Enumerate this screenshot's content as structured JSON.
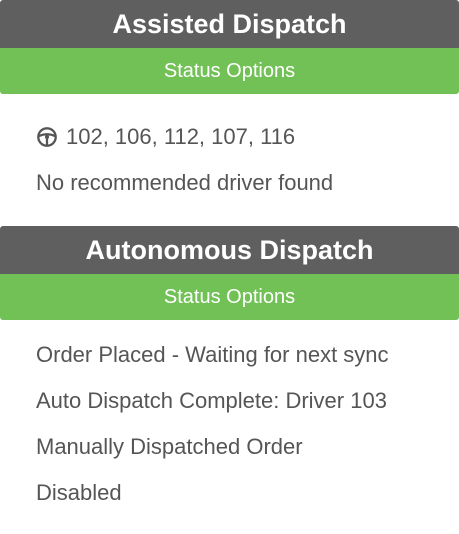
{
  "assisted": {
    "title": "Assisted Dispatch",
    "status_label": "Status Options",
    "drivers_icon": "steering-wheel-icon",
    "drivers": "102, 106, 112, 107, 116",
    "note": "No recommended driver found"
  },
  "autonomous": {
    "title": "Autonomous Dispatch",
    "status_label": "Status Options",
    "statuses": [
      "Order Placed - Waiting for next sync",
      "Auto Dispatch Complete: Driver 103",
      "Manually Dispatched Order",
      "Disabled"
    ]
  },
  "colors": {
    "header_bg": "#5f5f5f",
    "status_bg": "#72c157",
    "text": "#555555"
  }
}
